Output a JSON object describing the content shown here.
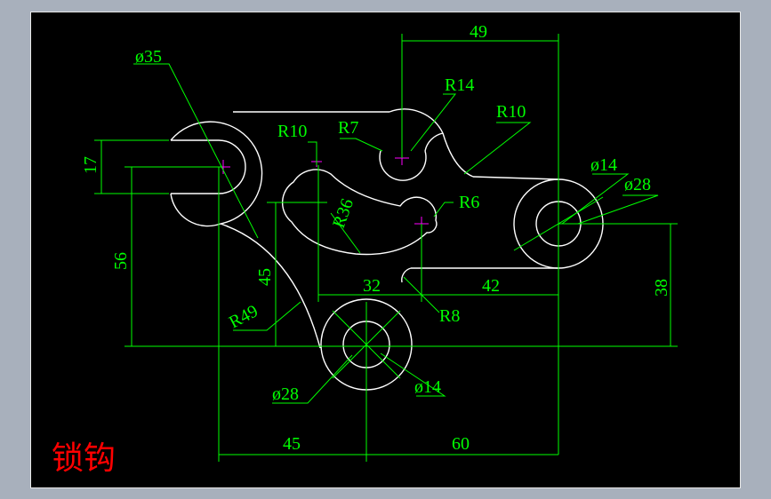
{
  "drawing": {
    "title": "锁钩",
    "colors": {
      "background": "#000000",
      "outline": "#ffffff",
      "dimension": "#00ff00",
      "center_mark": "#ff00ff",
      "title": "#ff0000"
    },
    "dimensions": {
      "dia35": "ø35",
      "r10_top": "R10",
      "r7": "R7",
      "r14": "R14",
      "r10_right": "R10",
      "d49": "49",
      "d17": "17",
      "d56": "56",
      "d45_vertical": "45",
      "r49": "R49",
      "r36": "R36",
      "r6": "R6",
      "dia14_right": "ø14",
      "dia28_right": "ø28",
      "d38": "38",
      "d32": "32",
      "d42": "42",
      "r8": "R8",
      "dia28_bottom": "ø28",
      "dia14_bottom": "ø14",
      "d45_bottom": "45",
      "d60": "60"
    }
  }
}
